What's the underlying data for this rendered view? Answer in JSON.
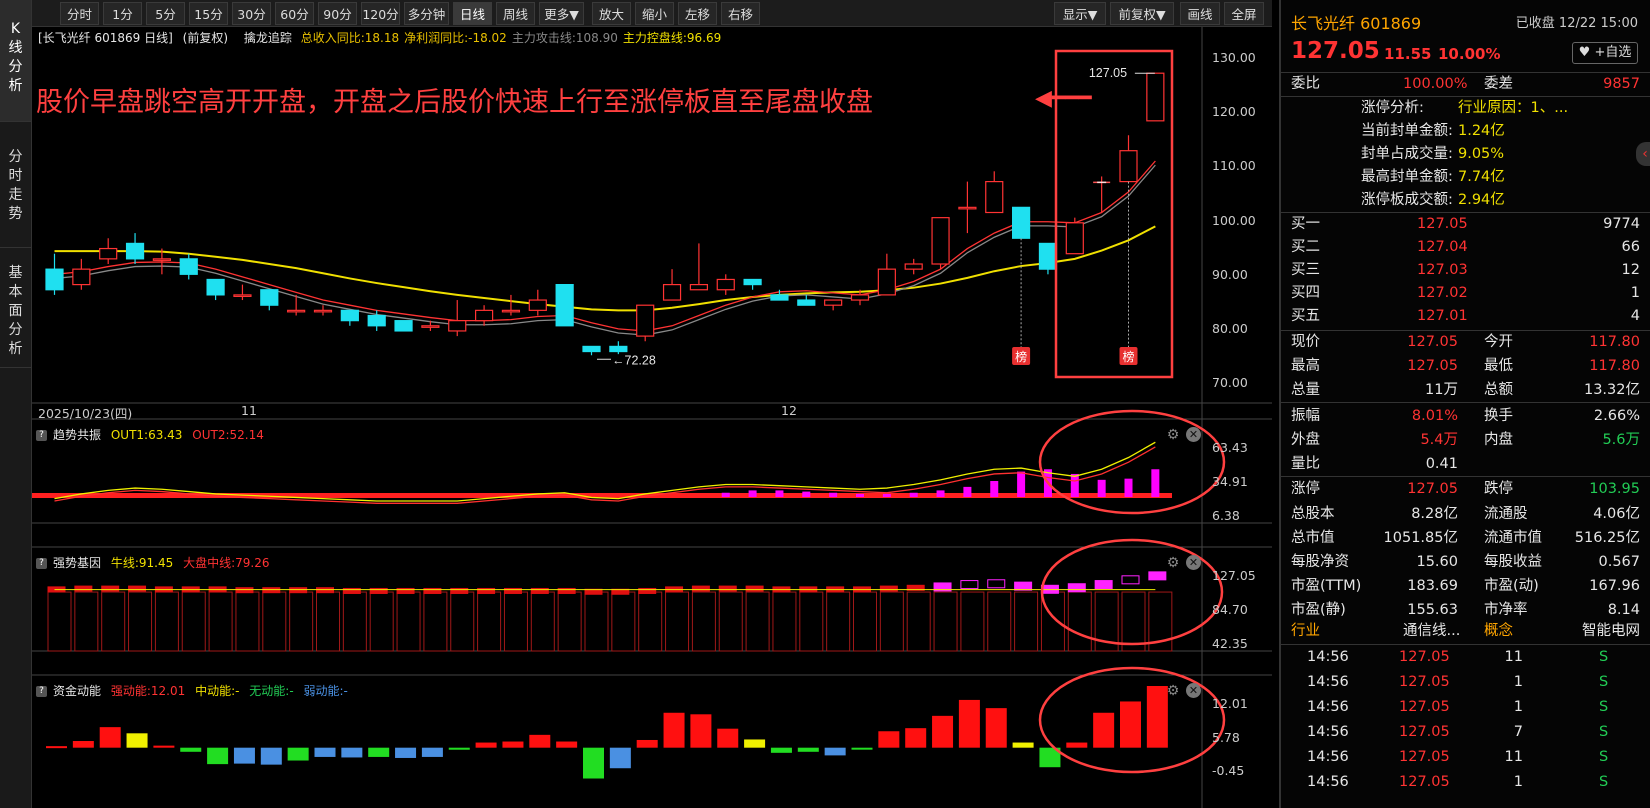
{
  "nav": {
    "tabs": [
      "K线分析",
      "分时走势",
      "基本面分析"
    ]
  },
  "toolbar": {
    "periods": [
      "分时",
      "1分",
      "5分",
      "15分",
      "30分",
      "60分",
      "90分",
      "120分",
      "多分钟",
      "日线",
      "周线",
      "更多▼"
    ],
    "active": "日线",
    "actions": [
      "放大",
      "缩小",
      "左移",
      "右移"
    ],
    "right": [
      "显示▼",
      "前复权▼",
      "画线",
      "全屏"
    ]
  },
  "main": {
    "stock_label": "[长飞光纤 601869 日线]",
    "adj_label": "(前复权)",
    "indicator_name": "擒龙追踪",
    "metrics": [
      {
        "text": "总收入同比:18.18",
        "color": "#e8c000"
      },
      {
        "text": "净利润同比:-18.02",
        "color": "#e8c000"
      },
      {
        "text": "主力攻击线:108.90",
        "color": "#888888"
      },
      {
        "text": "主力控盘线:96.69",
        "color": "#f0e000"
      }
    ],
    "annotation": "股价早盘跳空高开开盘，开盘之后股价快速上行至涨停板直至尾盘收盘",
    "arrow": "◀━━━",
    "y_ticks": [
      "130.00",
      "120.00",
      "110.00",
      "100.00",
      "90.00",
      "80.00",
      "70.00"
    ],
    "price_callout": "127.05",
    "low_callout": "72.28",
    "badge": "榜",
    "date_axis": [
      "2025/10/23(四)",
      "11",
      "12"
    ]
  },
  "colors": {
    "up": "#ff3333",
    "down": "#1fe0f0",
    "ma5": "#ff3333",
    "ma10": "#f0e000",
    "accent": "#ff4040"
  },
  "chart_data": [
    {
      "type": "candlestick",
      "title": "长飞光纤 601869 日线",
      "ylim": [
        68,
        133
      ],
      "y_ticks": [
        130,
        120,
        110,
        100,
        90,
        80,
        70
      ],
      "candles": [
        {
          "o": 89,
          "c": 85,
          "h": 92,
          "l": 84
        },
        {
          "o": 86,
          "c": 89,
          "h": 91,
          "l": 85
        },
        {
          "o": 91,
          "c": 93,
          "h": 95,
          "l": 90
        },
        {
          "o": 94,
          "c": 91,
          "h": 96,
          "l": 90
        },
        {
          "o": 91,
          "c": 91,
          "h": 93,
          "l": 88
        },
        {
          "o": 91,
          "c": 88,
          "h": 92,
          "l": 87
        },
        {
          "o": 87,
          "c": 84,
          "h": 87,
          "l": 83
        },
        {
          "o": 84,
          "c": 84,
          "h": 86,
          "l": 83
        },
        {
          "o": 85,
          "c": 82,
          "h": 85,
          "l": 81
        },
        {
          "o": 81,
          "c": 81,
          "h": 84,
          "l": 80
        },
        {
          "o": 81,
          "c": 81,
          "h": 82,
          "l": 80
        },
        {
          "o": 81,
          "c": 79,
          "h": 81,
          "l": 78
        },
        {
          "o": 80,
          "c": 78,
          "h": 81,
          "l": 77
        },
        {
          "o": 79,
          "c": 77,
          "h": 79,
          "l": 77
        },
        {
          "o": 78,
          "c": 78,
          "h": 79,
          "l": 77
        },
        {
          "o": 77,
          "c": 79,
          "h": 83,
          "l": 76
        },
        {
          "o": 79,
          "c": 81,
          "h": 82,
          "l": 78
        },
        {
          "o": 81,
          "c": 81,
          "h": 84,
          "l": 80
        },
        {
          "o": 81,
          "c": 83,
          "h": 85,
          "l": 80
        },
        {
          "o": 86,
          "c": 78,
          "h": 86,
          "l": 78
        },
        {
          "o": 74,
          "c": 73,
          "h": 74,
          "l": 72.28
        },
        {
          "o": 74,
          "c": 73,
          "h": 75,
          "l": 72.5
        },
        {
          "o": 76,
          "c": 82,
          "h": 82,
          "l": 75
        },
        {
          "o": 83,
          "c": 86,
          "h": 89,
          "l": 83
        },
        {
          "o": 85,
          "c": 86,
          "h": 94,
          "l": 85
        },
        {
          "o": 85,
          "c": 87,
          "h": 88,
          "l": 84
        },
        {
          "o": 87,
          "c": 86,
          "h": 87,
          "l": 85
        },
        {
          "o": 84,
          "c": 83,
          "h": 85,
          "l": 83
        },
        {
          "o": 83,
          "c": 82,
          "h": 84,
          "l": 82
        },
        {
          "o": 82,
          "c": 83,
          "h": 83,
          "l": 81
        },
        {
          "o": 83,
          "c": 84,
          "h": 85,
          "l": 82
        },
        {
          "o": 84,
          "c": 89,
          "h": 92,
          "l": 84
        },
        {
          "o": 89,
          "c": 90,
          "h": 91,
          "l": 88
        },
        {
          "o": 90,
          "c": 99,
          "h": 99,
          "l": 89
        },
        {
          "o": 101,
          "c": 101,
          "h": 106,
          "l": 96
        },
        {
          "o": 100,
          "c": 106,
          "h": 108,
          "l": 100
        },
        {
          "o": 101,
          "c": 95,
          "h": 101,
          "l": 95
        },
        {
          "o": 94,
          "c": 89,
          "h": 94,
          "l": 88
        },
        {
          "o": 92,
          "c": 98,
          "h": 99,
          "l": 92
        },
        {
          "o": 106,
          "c": 106,
          "h": 107,
          "l": 100
        },
        {
          "o": 106,
          "c": 112,
          "h": 115,
          "l": 106
        },
        {
          "o": 117.8,
          "c": 127.05,
          "h": 127.05,
          "l": 117.8
        }
      ],
      "ma_short": [
        88,
        88.5,
        89.5,
        90.3,
        90.4,
        90.2,
        89,
        87.5,
        86,
        84.5,
        83,
        82,
        81,
        80.3,
        79.6,
        79,
        79,
        79.2,
        79.8,
        80,
        78.6,
        77.4,
        77,
        78,
        80,
        82,
        83.6,
        84.6,
        84.8,
        84.4,
        84,
        85,
        86.6,
        89,
        93,
        96,
        98.2,
        98.2,
        98,
        100,
        104,
        110
      ],
      "ma_long": [
        92.5,
        92.5,
        92.5,
        92.5,
        92.4,
        92,
        91.4,
        90.8,
        90,
        89.2,
        88.2,
        87.2,
        86.3,
        85.5,
        84.7,
        84,
        83.4,
        82.8,
        82.2,
        81.7,
        81.2,
        81,
        81,
        81.5,
        82.2,
        83,
        83.6,
        84,
        84.3,
        84.5,
        84.6,
        84.9,
        85.4,
        86.2,
        87.3,
        88.6,
        89.6,
        90.2,
        91,
        92.6,
        94.6,
        97.3
      ]
    },
    {
      "type": "bar",
      "title": "趋势共振",
      "series": [
        {
          "name": "OUT1",
          "last": 63.43
        },
        {
          "name": "OUT2",
          "last": 52.14
        }
      ],
      "y_ticks": [
        63.43,
        34.91,
        6.38
      ],
      "bars_from_index": 25,
      "values": [
        0,
        0,
        0,
        0,
        0,
        0,
        0,
        0,
        0,
        0,
        0,
        0,
        0,
        0,
        0,
        0,
        0,
        0,
        0,
        0,
        0,
        0,
        0,
        0,
        0,
        10,
        12,
        12,
        11,
        10,
        9,
        9,
        10,
        12,
        15,
        20,
        28,
        30,
        26,
        21,
        22,
        30,
        42,
        50,
        63
      ]
    },
    {
      "type": "bar",
      "title": "强势基因",
      "series": [
        {
          "name": "牛线",
          "last": 91.45
        },
        {
          "name": "大盘中线",
          "last": 79.26
        }
      ],
      "y_ticks": [
        127.05,
        84.7,
        42.35
      ]
    },
    {
      "type": "bar",
      "title": "资金动能",
      "series": [
        {
          "name": "强动能",
          "last": "12.01"
        },
        {
          "name": "中动能",
          "last": "-"
        },
        {
          "name": "无动能",
          "last": "-"
        },
        {
          "name": "弱动能",
          "last": "-"
        }
      ],
      "y_ticks": [
        12.01,
        5.78,
        -0.45
      ],
      "values": [
        0.3,
        1.3,
        4,
        2.8,
        0.4,
        -0.8,
        -3.2,
        -3.1,
        -3.3,
        -2.5,
        -1.8,
        -1.9,
        -1.8,
        -2,
        -1.8,
        -0.4,
        1,
        1.2,
        2.5,
        1.2,
        -6,
        -4,
        1.5,
        6.8,
        6.5,
        3.7,
        1.6,
        -1,
        -0.8,
        -1.5,
        -0.3,
        3.2,
        3.8,
        6.2,
        9.3,
        7.7,
        1,
        -3.8,
        1,
        6.8,
        9,
        12.01
      ]
    }
  ],
  "sub1": {
    "name": "趋势共振",
    "l1": "OUT1:63.43",
    "l2": "OUT2:52.14",
    "ticks": [
      "63.43",
      "34.91",
      "6.38"
    ]
  },
  "sub2": {
    "name": "强势基因",
    "l1": "牛线:91.45",
    "l2": "大盘中线:79.26",
    "ticks": [
      "127.05",
      "84.70",
      "42.35"
    ]
  },
  "sub3": {
    "name": "资金动能",
    "l1": "强动能:12.01",
    "l2": "中动能:-",
    "l3": "无动能:-",
    "l4": "弱动能:-",
    "ticks": [
      "12.01",
      "5.78",
      "-0.45"
    ]
  },
  "side": {
    "name": "长飞光纤 601869",
    "status": "已收盘 12/22 15:00",
    "price": "127.05",
    "change": "11.55",
    "pct": "10.00%",
    "watch": "♥ +自选",
    "weibi_label": "委比",
    "weibi": "100.00%",
    "weicha_label": "委差",
    "weicha": "9857",
    "limit": [
      {
        "k": "涨停分析:",
        "v": "行业原因：1、..."
      },
      {
        "k": "当前封单金额:",
        "v": "1.24亿"
      },
      {
        "k": "封单占成交量:",
        "v": "9.05%"
      },
      {
        "k": "最高封单金额:",
        "v": "7.74亿"
      },
      {
        "k": "涨停板成交额:",
        "v": "2.94亿"
      }
    ],
    "bids": [
      {
        "k": "买一",
        "p": "127.05",
        "v": "9774"
      },
      {
        "k": "买二",
        "p": "127.04",
        "v": "66"
      },
      {
        "k": "买三",
        "p": "127.03",
        "v": "12"
      },
      {
        "k": "买四",
        "p": "127.02",
        "v": "1"
      },
      {
        "k": "买五",
        "p": "127.01",
        "v": "4"
      }
    ],
    "quote": [
      {
        "k1": "现价",
        "v1": "127.05",
        "c1": "red",
        "k2": "今开",
        "v2": "117.80",
        "c2": "red"
      },
      {
        "k1": "最高",
        "v1": "127.05",
        "c1": "red",
        "k2": "最低",
        "v2": "117.80",
        "c2": "red"
      },
      {
        "k1": "总量",
        "v1": "11万",
        "c1": "white",
        "k2": "总额",
        "v2": "13.32亿",
        "c2": "white"
      },
      {
        "k1": "振幅",
        "v1": "8.01%",
        "c1": "red",
        "k2": "换手",
        "v2": "2.66%",
        "c2": "white"
      },
      {
        "k1": "外盘",
        "v1": "5.4万",
        "c1": "red",
        "k2": "内盘",
        "v2": "5.6万",
        "c2": "green"
      },
      {
        "k1": "量比",
        "v1": "0.41",
        "c1": "white",
        "k2": "",
        "v2": "",
        "c2": "white"
      },
      {
        "k1": "涨停",
        "v1": "127.05",
        "c1": "red",
        "k2": "跌停",
        "v2": "103.95",
        "c2": "green"
      },
      {
        "k1": "总股本",
        "v1": "8.28亿",
        "c1": "white",
        "k2": "流通股",
        "v2": "4.06亿",
        "c2": "white"
      },
      {
        "k1": "总市值",
        "v1": "1051.85亿",
        "c1": "white",
        "k2": "流通市值",
        "v2": "516.25亿",
        "c2": "white"
      },
      {
        "k1": "每股净资",
        "v1": "15.60",
        "c1": "white",
        "k2": "每股收益",
        "v2": "0.567",
        "c2": "white"
      },
      {
        "k1": "市盈(TTM)",
        "v1": "183.69",
        "c1": "white",
        "k2": "市盈(动)",
        "v2": "167.96",
        "c2": "white"
      },
      {
        "k1": "市盈(静)",
        "v1": "155.63",
        "c1": "white",
        "k2": "市净率",
        "v2": "8.14",
        "c2": "white"
      }
    ],
    "industry_label": "行业",
    "industry": "通信线...",
    "concept_label": "概念",
    "concept": "智能电网",
    "ticks": [
      {
        "t": "14:56",
        "p": "127.05",
        "v": "11",
        "s": "S"
      },
      {
        "t": "14:56",
        "p": "127.05",
        "v": "1",
        "s": "S"
      },
      {
        "t": "14:56",
        "p": "127.05",
        "v": "1",
        "s": "S"
      },
      {
        "t": "14:56",
        "p": "127.05",
        "v": "7",
        "s": "S"
      },
      {
        "t": "14:56",
        "p": "127.05",
        "v": "11",
        "s": "S"
      },
      {
        "t": "14:56",
        "p": "127.05",
        "v": "1",
        "s": "S"
      }
    ]
  }
}
